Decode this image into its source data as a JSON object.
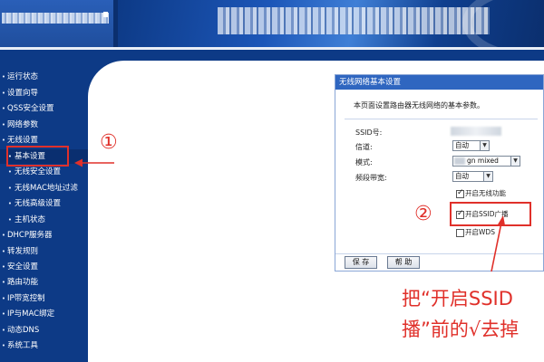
{
  "sidebar": {
    "items": [
      {
        "label": "运行状态",
        "sub": false
      },
      {
        "label": "设置向导",
        "sub": false
      },
      {
        "label": "QSS安全设置",
        "sub": false
      },
      {
        "label": "网络参数",
        "sub": false
      },
      {
        "label": "无线设置",
        "sub": false
      },
      {
        "label": "基本设置",
        "sub": true,
        "active": true
      },
      {
        "label": "无线安全设置",
        "sub": true
      },
      {
        "label": "无线MAC地址过滤",
        "sub": true
      },
      {
        "label": "无线高级设置",
        "sub": true
      },
      {
        "label": "主机状态",
        "sub": true
      },
      {
        "label": "DHCP服务器",
        "sub": false
      },
      {
        "label": "转发规则",
        "sub": false
      },
      {
        "label": "安全设置",
        "sub": false
      },
      {
        "label": "路由功能",
        "sub": false
      },
      {
        "label": "IP带宽控制",
        "sub": false
      },
      {
        "label": "IP与MAC绑定",
        "sub": false
      },
      {
        "label": "动态DNS",
        "sub": false
      },
      {
        "label": "系统工具",
        "sub": false
      }
    ]
  },
  "annotations": {
    "step1": "①",
    "step2": "②",
    "note_line1": "把“开启SSID",
    "note_line2": "播”前的√去掉"
  },
  "dialog": {
    "title": "无线网络基本设置",
    "description": "本页面设置路由器无线网络的基本参数。",
    "ssid_label": "SSID号:",
    "channel_label": "信道:",
    "channel_value": "自动",
    "mode_label": "模式:",
    "mode_value": "gn mixed",
    "bandwidth_label": "频段带宽:",
    "bandwidth_value": "自动",
    "checkbox_wireless": "开启无线功能",
    "checkbox_ssid_broadcast": "开启SSID广播",
    "checkbox_wds": "开启WDS",
    "save_button": "保 存",
    "help_button": "帮 助"
  },
  "colors": {
    "nav_bg": "#0d3a86",
    "dialog_title_bg": "#2f66c0",
    "annotation_red": "#e0302a"
  }
}
